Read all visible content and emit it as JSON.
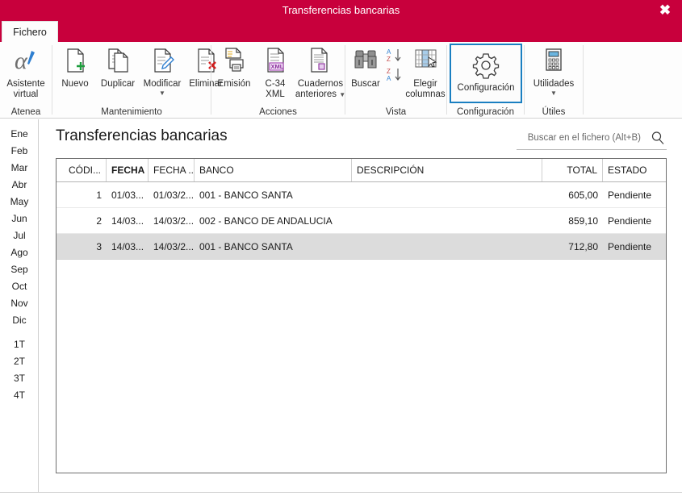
{
  "window": {
    "title": "Transferencias bancarias",
    "close_label": "✖",
    "accent_color": "#c8003c"
  },
  "ribbon": {
    "tabs": [
      {
        "label": "Fichero",
        "active": true
      }
    ],
    "groups": [
      {
        "label": "Atenea",
        "buttons": [
          {
            "name": "asistente-virtual",
            "label": "Asistente\nvirtual",
            "icon": "alpha-icon"
          }
        ]
      },
      {
        "label": "Mantenimiento",
        "buttons": [
          {
            "name": "nuevo",
            "label": "Nuevo",
            "icon": "document-plus-icon"
          },
          {
            "name": "duplicar",
            "label": "Duplicar",
            "icon": "document-copy-icon"
          },
          {
            "name": "modificar",
            "label": "Modificar",
            "icon": "document-pencil-icon",
            "caret": true
          },
          {
            "name": "eliminar",
            "label": "Eliminar",
            "icon": "document-delete-icon"
          }
        ]
      },
      {
        "label": "Acciones",
        "buttons": [
          {
            "name": "emision",
            "label": "Emisión",
            "icon": "printer-icon"
          },
          {
            "name": "c34-xml",
            "label": "C-34\nXML",
            "icon": "xml-document-icon"
          },
          {
            "name": "cuadernos-anteriores",
            "label": "Cuadernos\nanteriores",
            "icon": "documents-stack-icon",
            "caret_inline": true
          }
        ]
      },
      {
        "label": "Vista",
        "buttons": [
          {
            "name": "buscar",
            "label": "Buscar",
            "icon": "binoculars-icon"
          },
          {
            "name": "sort-az",
            "label": "",
            "icon": "sort-ascending-icon"
          },
          {
            "name": "sort-za",
            "label": "",
            "icon": "sort-descending-icon"
          },
          {
            "name": "elegir-columnas",
            "label": "Elegir\ncolumnas",
            "icon": "table-columns-icon"
          }
        ]
      },
      {
        "label": "Configuración",
        "buttons": [
          {
            "name": "configuracion",
            "label": "Configuración",
            "icon": "gear-icon",
            "selected": true
          }
        ]
      },
      {
        "label": "Útiles",
        "buttons": [
          {
            "name": "utilidades",
            "label": "Utilidades",
            "icon": "calculator-icon",
            "caret": true
          }
        ]
      }
    ],
    "labels": {
      "atenea": "Atenea",
      "mantenimiento": "Mantenimiento",
      "acciones": "Acciones",
      "vista": "Vista",
      "configuracion": "Configuración",
      "utiles": "Útiles",
      "asistente_l1": "Asistente",
      "asistente_l2": "virtual",
      "nuevo": "Nuevo",
      "duplicar": "Duplicar",
      "modificar": "Modificar",
      "eliminar": "Eliminar",
      "emision": "Emisión",
      "c34_l1": "C-34",
      "c34_l2": "XML",
      "cuadernos_l1": "Cuadernos",
      "cuadernos_l2": "anteriores",
      "buscar": "Buscar",
      "elegir_l1": "Elegir",
      "elegir_l2": "columnas",
      "configuracion_btn": "Configuración",
      "utilidades": "Utilidades"
    }
  },
  "sidebar": {
    "months": [
      "Ene",
      "Feb",
      "Mar",
      "Abr",
      "May",
      "Jun",
      "Jul",
      "Ago",
      "Sep",
      "Oct",
      "Nov",
      "Dic"
    ],
    "quarters": [
      "1T",
      "2T",
      "3T",
      "4T"
    ]
  },
  "main": {
    "page_title": "Transferencias bancarias",
    "search": {
      "placeholder": "Buscar en el fichero (Alt+B)",
      "value": ""
    },
    "grid": {
      "columns": [
        {
          "key": "codigo",
          "label": "CÓDI...",
          "align": "right",
          "bold": false
        },
        {
          "key": "fecha",
          "label": "FECHA",
          "align": "right",
          "bold": true
        },
        {
          "key": "fecha2",
          "label": "FECHA ...",
          "align": "right",
          "bold": false
        },
        {
          "key": "banco",
          "label": "BANCO",
          "align": "left",
          "bold": false
        },
        {
          "key": "descripcion",
          "label": "DESCRIPCIÓN",
          "align": "left",
          "bold": false
        },
        {
          "key": "total",
          "label": "TOTAL",
          "align": "right",
          "bold": false
        },
        {
          "key": "estado",
          "label": "ESTADO",
          "align": "left",
          "bold": false
        }
      ],
      "rows": [
        {
          "codigo": "1",
          "fecha": "01/03...",
          "fecha2": "01/03/2...",
          "banco": "001 - BANCO SANTA",
          "descripcion": "",
          "total": "605,00",
          "estado": "Pendiente",
          "selected": false
        },
        {
          "codigo": "2",
          "fecha": "14/03...",
          "fecha2": "14/03/2...",
          "banco": "002 - BANCO DE ANDALUCIA",
          "descripcion": "",
          "total": "859,10",
          "estado": "Pendiente",
          "selected": false
        },
        {
          "codigo": "3",
          "fecha": "14/03...",
          "fecha2": "14/03/2...",
          "banco": "001 - BANCO SANTA",
          "descripcion": "",
          "total": "712,80",
          "estado": "Pendiente",
          "selected": true
        }
      ]
    }
  }
}
